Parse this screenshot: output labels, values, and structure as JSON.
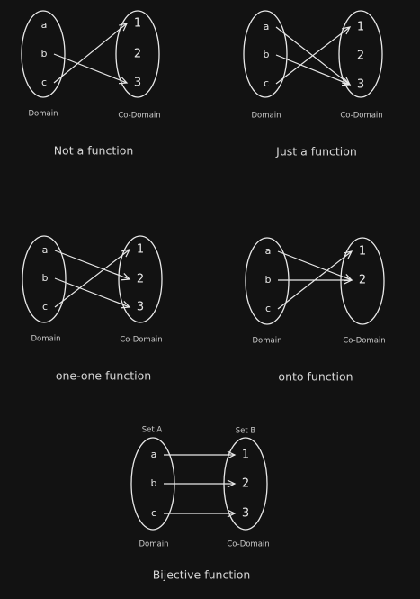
{
  "diagrams": [
    {
      "id": "not-a-function",
      "domain_label": "Domain",
      "codomain_label": "Co-Domain",
      "domain_elements": [
        "a",
        "b",
        "c"
      ],
      "codomain_elements": [
        "1",
        "2",
        "3"
      ],
      "mapping": [
        [
          "b",
          "3"
        ],
        [
          "c",
          "1"
        ]
      ],
      "caption": "Not a function"
    },
    {
      "id": "just-a-function",
      "domain_label": "Domain",
      "codomain_label": "Co-Domain",
      "domain_elements": [
        "a",
        "b",
        "c"
      ],
      "codomain_elements": [
        "1",
        "2",
        "3"
      ],
      "mapping": [
        [
          "a",
          "3"
        ],
        [
          "b",
          "3"
        ],
        [
          "c",
          "1"
        ]
      ],
      "caption": "Just a function"
    },
    {
      "id": "one-one-function",
      "domain_label": "Domain",
      "codomain_label": "Co-Domain",
      "domain_elements": [
        "a",
        "b",
        "c"
      ],
      "codomain_elements": [
        "1",
        "2",
        "3"
      ],
      "mapping": [
        [
          "a",
          "2"
        ],
        [
          "b",
          "3"
        ],
        [
          "c",
          "1"
        ]
      ],
      "caption": "one-one function"
    },
    {
      "id": "onto-function",
      "domain_label": "Domain",
      "codomain_label": "Co-Domain",
      "domain_elements": [
        "a",
        "b",
        "c"
      ],
      "codomain_elements": [
        "1",
        "2"
      ],
      "mapping": [
        [
          "a",
          "2"
        ],
        [
          "b",
          "2"
        ],
        [
          "c",
          "1"
        ]
      ],
      "caption": "onto function"
    },
    {
      "id": "bijective-function",
      "domain_set_label": "Set A",
      "codomain_set_label": "Set B",
      "domain_label": "Domain",
      "codomain_label": "Co-Domain",
      "domain_elements": [
        "a",
        "b",
        "c"
      ],
      "codomain_elements": [
        "1",
        "2",
        "3"
      ],
      "mapping": [
        [
          "a",
          "1"
        ],
        [
          "b",
          "2"
        ],
        [
          "c",
          "3"
        ]
      ],
      "caption": "Bijective function"
    }
  ],
  "colors": {
    "background": "#121212",
    "stroke": "#e8e8e8",
    "small_label": "#c9c9c9",
    "caption": "#d6d6d6"
  }
}
